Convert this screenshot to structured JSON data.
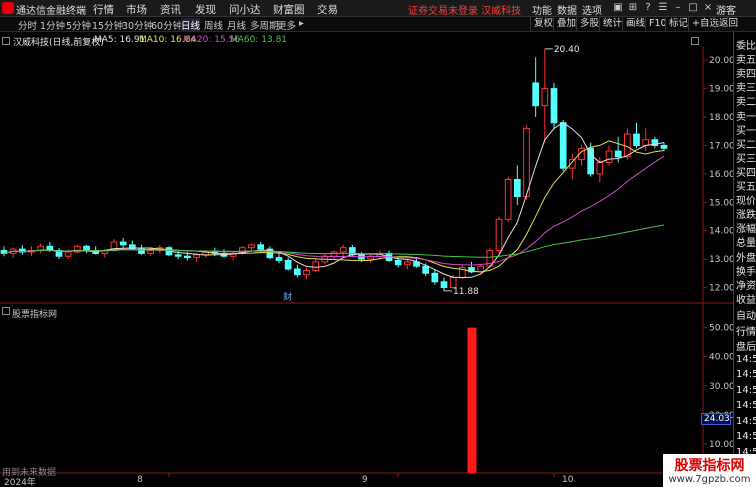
{
  "titlebar": {
    "app_title": "通达信金融终端",
    "menus": [
      "行情",
      "市场",
      "资讯",
      "发现",
      "问小达",
      "财富圈",
      "交易"
    ],
    "notice": "证券交易未登录  汉威科技",
    "right_items": [
      "功能",
      "数据",
      "选项",
      "游客"
    ]
  },
  "toolbar": {
    "periods": [
      "分时",
      "1分钟",
      "5分钟",
      "15分钟",
      "30分钟",
      "60分钟",
      "日线",
      "周线",
      "月线",
      "多周期",
      "更多"
    ],
    "active_period": "日线",
    "right_tools": [
      "复权",
      "叠加",
      "多股",
      "统计",
      "画线",
      "F10",
      "标记",
      "+自选",
      "返回"
    ]
  },
  "chart_header": {
    "title": "汉威科技(日线,前复权)",
    "ma": [
      {
        "label": "MA5: 16.91",
        "color": "#e0e0e0"
      },
      {
        "label": "MA10: 16.64",
        "color": "#e8e04a"
      },
      {
        "label": "MA20: 15.56",
        "color": "#d24ad2"
      },
      {
        "label": "MA60: 13.81",
        "color": "#49c24a"
      }
    ]
  },
  "right_panel": {
    "labels_top": [
      "委比",
      "卖五",
      "卖四",
      "卖三",
      "卖二",
      "卖一",
      "买一",
      "买二",
      "买三",
      "买四",
      "买五",
      "现价",
      "涨跌",
      "涨幅",
      "总量",
      "外盘",
      "换手",
      "净资",
      "收益"
    ],
    "labels_bottom": [
      "自动",
      "行情",
      "盘后",
      "14:50",
      "14:50",
      "14:50",
      "14:50",
      "14:50",
      "14:50",
      "14:50"
    ]
  },
  "indicator": {
    "title": "股票指标网",
    "cursor_value": "24.03",
    "footer_note": "用到未来数据"
  },
  "watermark": {
    "title": "股票指标网",
    "url": "www.7gpzb.com"
  },
  "price_annotations": {
    "high_label": "20.40",
    "low_label": "11.88",
    "event_marker": "财"
  },
  "chart_data": [
    {
      "type": "candlestick",
      "title": "汉威科技(日线,前复权)",
      "y_ticks": [
        "20.00",
        "19.00",
        "18.00",
        "17.00",
        "16.00",
        "15.00",
        "14.00",
        "13.00",
        "12.00"
      ],
      "ylim": [
        11.7,
        20.5
      ],
      "x_ticks": [
        "2024年",
        "8",
        "9",
        "10"
      ],
      "candles": [
        [
          13.3,
          13.45,
          13.1,
          13.2
        ],
        [
          13.2,
          13.4,
          13.05,
          13.35
        ],
        [
          13.35,
          13.5,
          13.15,
          13.25
        ],
        [
          13.25,
          13.45,
          13.1,
          13.3
        ],
        [
          13.3,
          13.55,
          13.2,
          13.45
        ],
        [
          13.45,
          13.6,
          13.25,
          13.3
        ],
        [
          13.3,
          13.4,
          13.0,
          13.1
        ],
        [
          13.1,
          13.35,
          13.0,
          13.25
        ],
        [
          13.25,
          13.5,
          13.2,
          13.45
        ],
        [
          13.45,
          13.5,
          13.2,
          13.3
        ],
        [
          13.3,
          13.45,
          13.15,
          13.2
        ],
        [
          13.2,
          13.35,
          13.05,
          13.3
        ],
        [
          13.3,
          13.7,
          13.25,
          13.6
        ],
        [
          13.6,
          13.75,
          13.4,
          13.5
        ],
        [
          13.5,
          13.65,
          13.3,
          13.35
        ],
        [
          13.35,
          13.5,
          13.15,
          13.2
        ],
        [
          13.2,
          13.4,
          13.1,
          13.3
        ],
        [
          13.3,
          13.5,
          13.2,
          13.4
        ],
        [
          13.4,
          13.45,
          13.1,
          13.15
        ],
        [
          13.15,
          13.3,
          13.0,
          13.1
        ],
        [
          13.1,
          13.25,
          12.95,
          13.05
        ],
        [
          13.05,
          13.2,
          12.9,
          13.15
        ],
        [
          13.15,
          13.3,
          13.05,
          13.25
        ],
        [
          13.25,
          13.4,
          13.1,
          13.2
        ],
        [
          13.2,
          13.35,
          13.05,
          13.1
        ],
        [
          13.1,
          13.25,
          12.95,
          13.2
        ],
        [
          13.2,
          13.45,
          13.15,
          13.4
        ],
        [
          13.4,
          13.55,
          13.3,
          13.5
        ],
        [
          13.5,
          13.6,
          13.3,
          13.35
        ],
        [
          13.35,
          13.45,
          13.0,
          13.05
        ],
        [
          13.05,
          13.2,
          12.85,
          12.95
        ],
        [
          12.95,
          13.05,
          12.6,
          12.65
        ],
        [
          12.65,
          12.8,
          12.35,
          12.45
        ],
        [
          12.45,
          12.7,
          12.3,
          12.6
        ],
        [
          12.6,
          13.0,
          12.55,
          12.9
        ],
        [
          12.9,
          13.2,
          12.8,
          13.1
        ],
        [
          13.1,
          13.3,
          13.0,
          13.25
        ],
        [
          13.25,
          13.5,
          13.1,
          13.4
        ],
        [
          13.4,
          13.5,
          13.1,
          13.15
        ],
        [
          13.15,
          13.25,
          12.9,
          13.0
        ],
        [
          13.0,
          13.2,
          12.85,
          13.1
        ],
        [
          13.1,
          13.3,
          13.0,
          13.2
        ],
        [
          13.2,
          13.3,
          12.9,
          12.95
        ],
        [
          12.95,
          13.05,
          12.7,
          12.8
        ],
        [
          12.8,
          13.0,
          12.65,
          12.9
        ],
        [
          12.9,
          13.05,
          12.7,
          12.75
        ],
        [
          12.75,
          12.85,
          12.4,
          12.5
        ],
        [
          12.5,
          12.65,
          12.1,
          12.2
        ],
        [
          12.2,
          12.35,
          11.88,
          12.0
        ],
        [
          12.0,
          12.45,
          11.95,
          12.35
        ],
        [
          12.35,
          12.8,
          12.3,
          12.7
        ],
        [
          12.7,
          12.9,
          12.5,
          12.55
        ],
        [
          12.55,
          12.8,
          12.5,
          12.75
        ],
        [
          12.75,
          13.4,
          12.7,
          13.3
        ],
        [
          13.3,
          14.5,
          13.2,
          14.4
        ],
        [
          14.4,
          15.9,
          14.3,
          15.8
        ],
        [
          15.8,
          16.3,
          14.9,
          15.2
        ],
        [
          15.2,
          17.7,
          15.1,
          17.6
        ],
        [
          19.2,
          20.1,
          18.0,
          18.4
        ],
        [
          18.4,
          20.4,
          17.1,
          19.0
        ],
        [
          19.0,
          19.2,
          17.6,
          17.8
        ],
        [
          17.8,
          17.9,
          16.1,
          16.2
        ],
        [
          16.2,
          16.7,
          15.8,
          16.5
        ],
        [
          16.5,
          17.0,
          16.3,
          16.9
        ],
        [
          16.9,
          17.1,
          15.9,
          16.0
        ],
        [
          16.0,
          16.6,
          15.7,
          16.4
        ],
        [
          16.4,
          17.0,
          16.3,
          16.8
        ],
        [
          16.8,
          17.3,
          16.4,
          16.6
        ],
        [
          16.6,
          17.6,
          16.5,
          17.4
        ],
        [
          17.4,
          17.8,
          16.9,
          17.0
        ],
        [
          17.0,
          17.6,
          16.8,
          17.2
        ],
        [
          17.2,
          17.3,
          16.9,
          17.0
        ],
        [
          17.0,
          17.1,
          16.8,
          16.9
        ]
      ]
    },
    {
      "type": "bar",
      "title": "股票指标网",
      "y_ticks": [
        "50.00",
        "40.00",
        "30.00",
        "20.00",
        "10.00"
      ],
      "ylim": [
        0,
        54
      ],
      "bars": [
        {
          "index": 51,
          "value": 50.0,
          "color": "#ff1a1a"
        }
      ]
    }
  ]
}
